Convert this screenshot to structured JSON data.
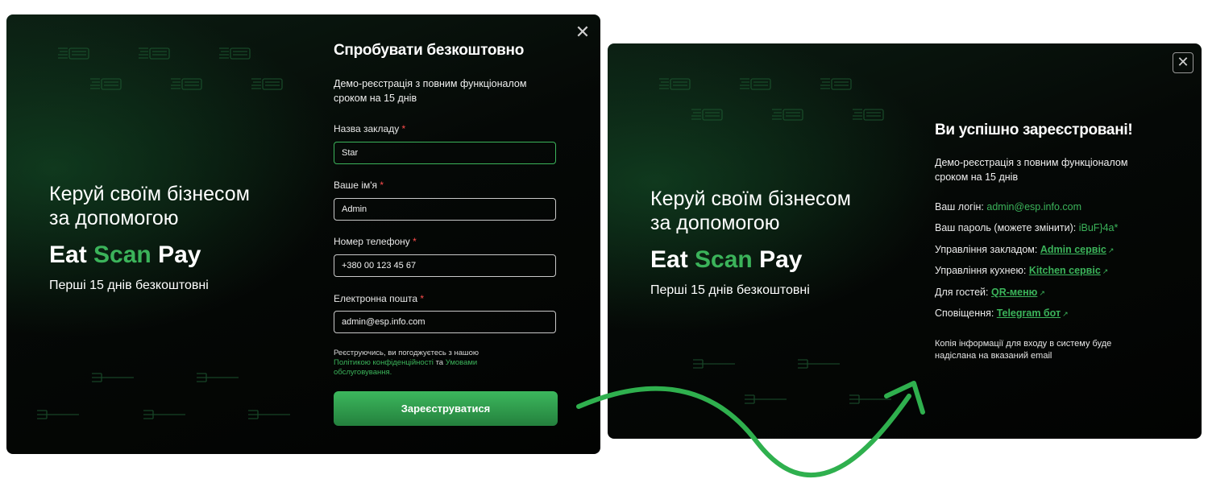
{
  "left_panel": {
    "close_glyph": "✕",
    "hero": {
      "line1": "Керуй своїм бізнесом",
      "line2": "за допомогою",
      "brand_eat": "Eat",
      "brand_scan": "Scan",
      "brand_pay": "Pay",
      "subtitle": "Перші 15 днів безкоштовні"
    },
    "form": {
      "title": "Спробувати безкоштовно",
      "description_line1": "Демо-реєстрація з повним функціоналом",
      "description_line2": "сроком на 15 днів",
      "required_mark": "*",
      "fields": [
        {
          "label": "Назва закладу",
          "value": "Star"
        },
        {
          "label": "Ваше ім'я",
          "value": "Admin"
        },
        {
          "label": "Номер телефону",
          "value": "+380 00 123 45 67"
        },
        {
          "label": "Електронна пошта",
          "value": "admin@esp.info.com"
        }
      ],
      "terms_prefix": "Реєструючись, ви погоджуєтесь з нашою",
      "privacy_link": "Політикою конфіденційності",
      "terms_and": "та",
      "terms_link": "Умовами обслуговування.",
      "submit_label": "Зареєструватися"
    }
  },
  "right_panel": {
    "close_glyph": "✕",
    "hero": {
      "line1": "Керуй своїм бізнесом",
      "line2": "за допомогою",
      "brand_eat": "Eat",
      "brand_scan": "Scan",
      "brand_pay": "Pay",
      "subtitle": "Перші 15 днів безкоштовні"
    },
    "success": {
      "title": "Ви успішно зареєстровані!",
      "description_line1": "Демо-реєстрація з повним функціоналом",
      "description_line2": "сроком на 15 днів",
      "login_label": "Ваш логін:",
      "login_value": "admin@esp.info.com",
      "password_label": "Ваш пароль (можете змінити):",
      "password_value": "iBuF}4a*",
      "admin_label": "Управління закладом:",
      "admin_link": "Admin сервіс",
      "kitchen_label": "Управління кухнею:",
      "kitchen_link": "Kitchen сервіс",
      "guests_label": "Для гостей:",
      "guests_link": "QR-меню",
      "notify_label": "Сповіщення:",
      "notify_link": "Telegram бот",
      "external_glyph": "↗",
      "note_line1": "Копія інформації для входу в систему буде",
      "note_line2": "надіслана на вказаний email"
    }
  },
  "colors": {
    "accent": "#3bb35a",
    "panel_bg": "#050806",
    "required": "#ff4d4d",
    "page_bg": "#ffffff"
  },
  "icons": [
    "close-icon",
    "external-link-icon",
    "receipt-icon",
    "fork-icon",
    "curved-arrow-icon"
  ]
}
